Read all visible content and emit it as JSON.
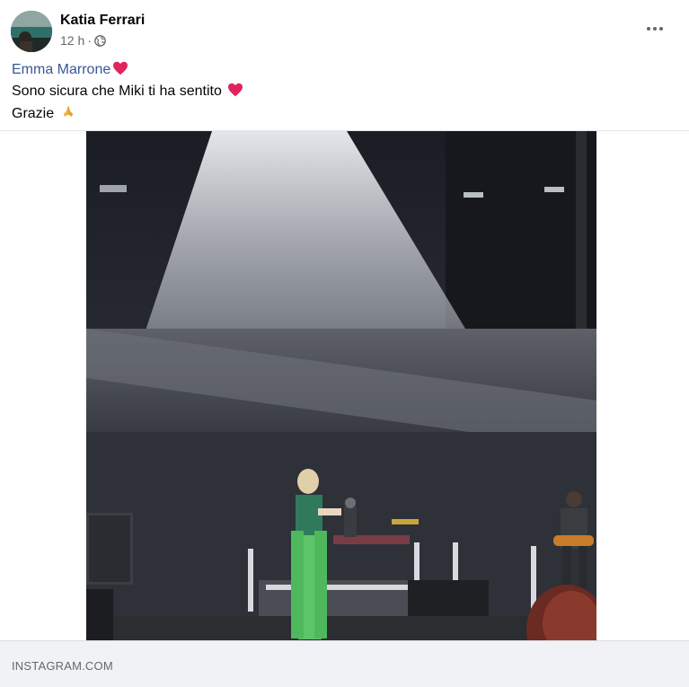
{
  "post": {
    "author": "Katia Ferrari",
    "timestamp": "12 h",
    "separator": "·",
    "privacy_icon": "globe-icon",
    "more_icon": "more-options-icon",
    "mention": "Emma Marrone",
    "line2": "Sono sicura che Miki ti ha sentito",
    "line3": "Grazie",
    "emoji_heart": "red-heart",
    "emoji_pray": "folded-hands"
  },
  "link_preview": {
    "source": "INSTAGRAM.COM"
  },
  "colors": {
    "mention": "#385898",
    "secondary_text": "#65676b",
    "footer_bg": "#f0f2f5",
    "heart": "#e0245e"
  }
}
